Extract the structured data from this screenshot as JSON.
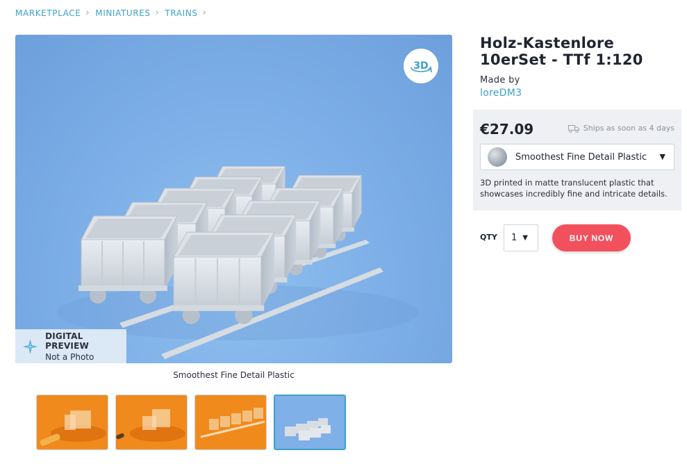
{
  "breadcrumb": [
    "MARKETPLACE",
    "MINIATURES",
    "TRAINS"
  ],
  "viewer": {
    "badge_3d": "3D",
    "preview_title": "DIGITAL PREVIEW",
    "preview_subtitle": "Not a Photo",
    "caption": "Smoothest Fine Detail Plastic"
  },
  "thumbnails": [
    {
      "label": "thumbnail-1",
      "style": "orange-photo"
    },
    {
      "label": "thumbnail-2",
      "style": "orange-photo"
    },
    {
      "label": "thumbnail-3",
      "style": "orange-photo"
    },
    {
      "label": "thumbnail-4",
      "style": "digital-preview",
      "active": true
    }
  ],
  "product": {
    "title": "Holz-Kastenlore 10erSet - TTf 1:120",
    "made_by_label": "Made by",
    "maker": "loreDM3",
    "price": "€27.09",
    "ships": "Ships as soon as 4 days",
    "material": "Smoothest Fine Detail Plastic",
    "material_description": "3D printed in matte translucent plastic that showcases incredibly fine and intricate details.",
    "qty_label": "QTY",
    "qty_value": "1",
    "buy_label": "BUY NOW"
  },
  "colors": {
    "accent": "#3aa0c8",
    "buy_button": "#f2505d",
    "viewer_bg": "#7fb0e8",
    "panel_bg": "#eef0f3"
  },
  "icons": [
    "chevron-right-icon",
    "rotate-3d-icon",
    "sparkle-icon",
    "truck-icon",
    "chevron-down-icon"
  ]
}
